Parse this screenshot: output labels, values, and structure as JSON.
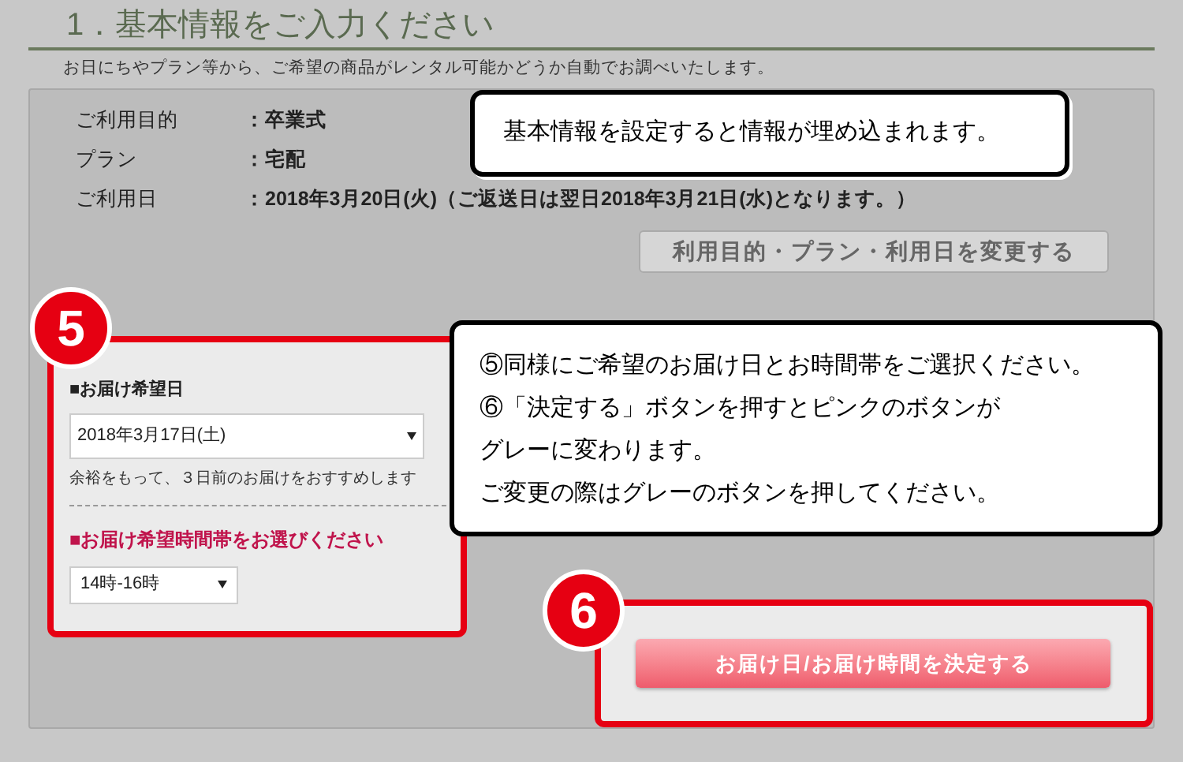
{
  "heading": "1．基本情報をご入力ください",
  "intro": "お日にちやプラン等から、ご希望の商品がレンタル可能かどうか自動でお調べいたします。",
  "info_rows": [
    {
      "label": "ご利用目的",
      "value": "：卒業式"
    },
    {
      "label": "プラン",
      "value": "：宅配"
    },
    {
      "label": "ご利用日",
      "value": "：2018年3月20日(火)（ご返送日は翌日2018年3月21日(水)となります。）"
    }
  ],
  "change_button": "利用目的・プラン・利用日を変更する",
  "delivery": {
    "badge": "5",
    "date_label": "■お届け希望日",
    "date_value": "2018年3月17日(土)",
    "date_note": "余裕をもって、３日前のお届けをおすすめします",
    "time_label": "■お届け希望時間帯をお選びください",
    "time_value": "14時-16時"
  },
  "confirm": {
    "badge": "6",
    "button": "お届け日/お届け時間を決定する"
  },
  "callouts": [
    {
      "lines": [
        "基本情報を設定すると情報が埋め込まれます。"
      ]
    },
    {
      "lines": [
        "⑤同様にご希望のお届け日とお時間帯をご選択ください。",
        "⑥「決定する」ボタンを押すとピンクのボタンが",
        "グレーに変わります。",
        "ご変更の際はグレーのボタンを押してください。"
      ]
    }
  ]
}
